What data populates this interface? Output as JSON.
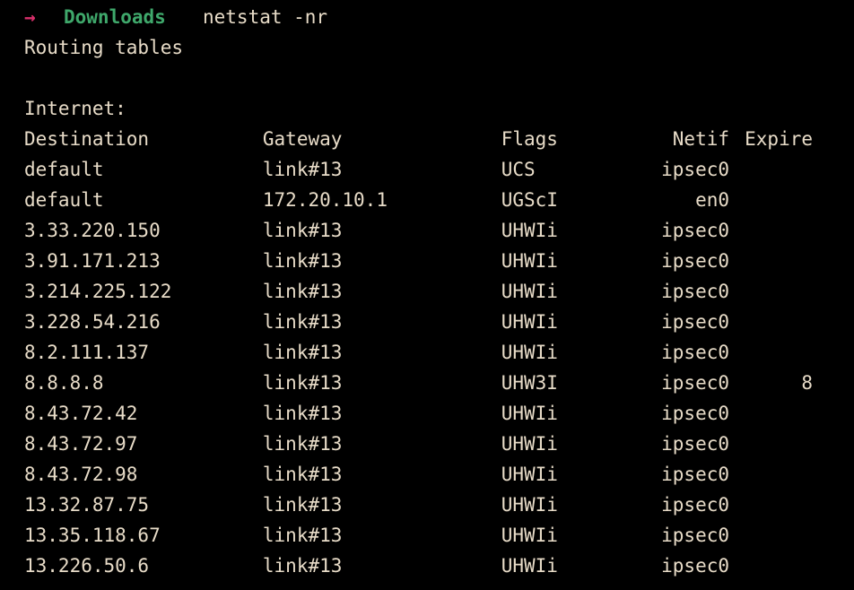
{
  "terminal": {
    "background_color": "#000000",
    "text_color": "#e8dcc8",
    "prompt": {
      "arrow_glyph": "→",
      "arrow_color": "#d9306c",
      "directory": "Downloads",
      "directory_color": "#3fa86b",
      "command": "netstat -nr"
    },
    "output": {
      "title": "Routing tables",
      "section": "Internet:",
      "columns": [
        "Destination",
        "Gateway",
        "Flags",
        "Netif",
        "Expire"
      ],
      "rows": [
        {
          "destination": "default",
          "gateway": "link#13",
          "flags": "UCS",
          "netif": "ipsec0",
          "expire": ""
        },
        {
          "destination": "default",
          "gateway": "172.20.10.1",
          "flags": "UGScI",
          "netif": "en0",
          "expire": ""
        },
        {
          "destination": "3.33.220.150",
          "gateway": "link#13",
          "flags": "UHWIi",
          "netif": "ipsec0",
          "expire": ""
        },
        {
          "destination": "3.91.171.213",
          "gateway": "link#13",
          "flags": "UHWIi",
          "netif": "ipsec0",
          "expire": ""
        },
        {
          "destination": "3.214.225.122",
          "gateway": "link#13",
          "flags": "UHWIi",
          "netif": "ipsec0",
          "expire": ""
        },
        {
          "destination": "3.228.54.216",
          "gateway": "link#13",
          "flags": "UHWIi",
          "netif": "ipsec0",
          "expire": ""
        },
        {
          "destination": "8.2.111.137",
          "gateway": "link#13",
          "flags": "UHWIi",
          "netif": "ipsec0",
          "expire": ""
        },
        {
          "destination": "8.8.8.8",
          "gateway": "link#13",
          "flags": "UHW3I",
          "netif": "ipsec0",
          "expire": "8"
        },
        {
          "destination": "8.43.72.42",
          "gateway": "link#13",
          "flags": "UHWIi",
          "netif": "ipsec0",
          "expire": ""
        },
        {
          "destination": "8.43.72.97",
          "gateway": "link#13",
          "flags": "UHWIi",
          "netif": "ipsec0",
          "expire": ""
        },
        {
          "destination": "8.43.72.98",
          "gateway": "link#13",
          "flags": "UHWIi",
          "netif": "ipsec0",
          "expire": ""
        },
        {
          "destination": "13.32.87.75",
          "gateway": "link#13",
          "flags": "UHWIi",
          "netif": "ipsec0",
          "expire": ""
        },
        {
          "destination": "13.35.118.67",
          "gateway": "link#13",
          "flags": "UHWIi",
          "netif": "ipsec0",
          "expire": ""
        },
        {
          "destination": "13.226.50.6",
          "gateway": "link#13",
          "flags": "UHWIi",
          "netif": "ipsec0",
          "expire": ""
        }
      ]
    }
  }
}
